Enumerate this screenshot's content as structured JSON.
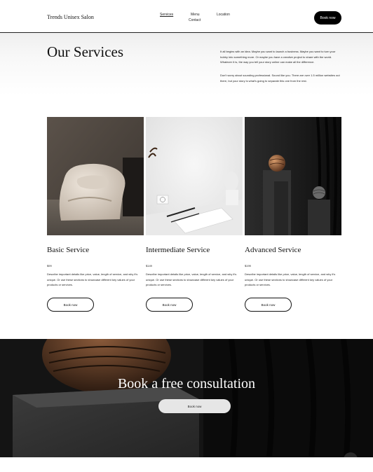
{
  "header": {
    "brand": "Trends Unisex Salon",
    "nav": {
      "services": "Services",
      "menu": "Menu",
      "location": "Location",
      "contact": "Contact"
    },
    "book_label": "Book now"
  },
  "intro": {
    "title": "Our Services",
    "p1": "It all begins with an idea. Maybe you want to launch a business. Maybe you want to turn your hobby into something more. Or maybe you have a creative project to share with the world. Whatever it is, the way you tell your story online can make all the difference.",
    "p2": "Don't worry about sounding professional. Sound like you. There are over 1.5 million websites out there, but your story is what's going to separate this one from the rest."
  },
  "services": [
    {
      "title": "Basic Service",
      "price": "$99",
      "desc": "Describe important details like price, value, length of service, and why it's unique. Or use these sections to showcase different key values of your products or services.",
      "button": "Book now"
    },
    {
      "title": "Intermediate Service",
      "price": "$149",
      "desc": "Describe important details like price, value, length of service, and why it's unique. Or use these sections to showcase different key values of your products or services.",
      "button": "Book now"
    },
    {
      "title": "Advanced Service",
      "price": "$199",
      "desc": "Describe important details like price, value, length of service, and why it's unique. Or use these sections to showcase different key values of your products or services.",
      "button": "Book now"
    }
  ],
  "banner": {
    "title": "Book a free consultation",
    "button": "Book now"
  }
}
